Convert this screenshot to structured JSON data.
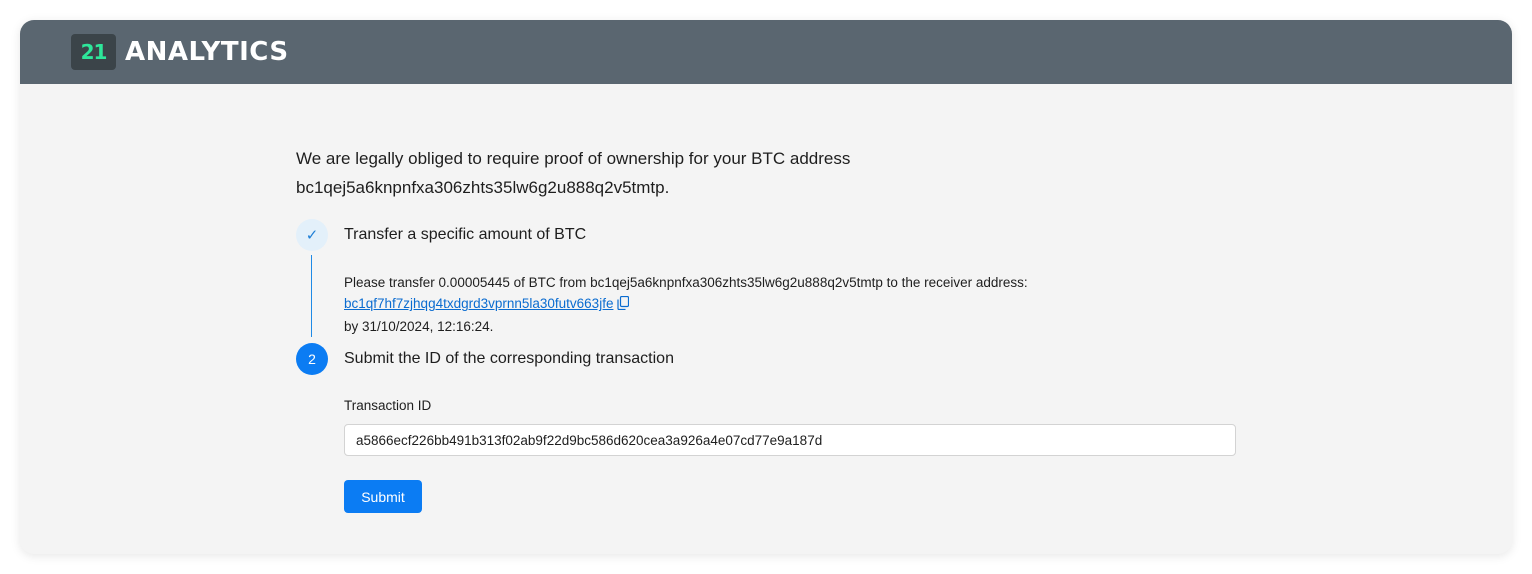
{
  "header": {
    "logo_mark": "21",
    "logo_text": "ANALYTICS"
  },
  "intro": {
    "line1": "We are legally obliged to require proof of ownership for your BTC address",
    "line2": "bc1qej5a6knpnfxa306zhts35lw6g2u888q2v5tmtp."
  },
  "steps": [
    {
      "status": "done",
      "icon": "check-icon",
      "icon_text": "✓",
      "title": "Transfer a specific amount of BTC",
      "instruction": "Please transfer 0.00005445 of BTC from bc1qej5a6knpnfxa306zhts35lw6g2u888q2v5tmtp to the receiver address:",
      "receiver_address": "bc1qf7hf7zjhqg4txdgrd3vprnn5la30futv663jfe",
      "deadline": "by 31/10/2024, 12:16:24."
    },
    {
      "status": "active",
      "number": "2",
      "title": "Submit the ID of the corresponding transaction",
      "field_label": "Transaction ID",
      "field_value": "a5866ecf226bb491b313f02ab9f22d9bc586d620cea3a926a4e07cd77e9a187d",
      "submit_label": "Submit"
    }
  ],
  "colors": {
    "header_bg": "#5a6670",
    "logo_accent": "#2ee69a",
    "primary": "#0b7cf3",
    "link": "#0b6cd0",
    "page_bg": "#f4f4f4"
  }
}
